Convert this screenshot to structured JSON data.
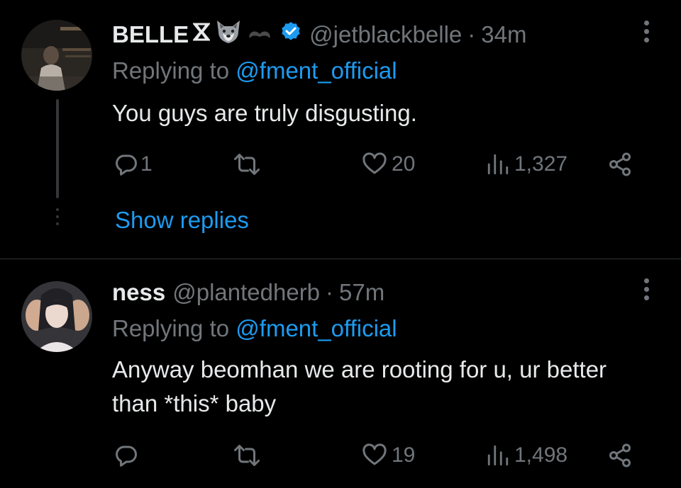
{
  "tweets": [
    {
      "display_name": "BELLE",
      "name_emojis": [
        "x-emoji",
        "wolf-emoji",
        "mustache-emoji"
      ],
      "verified": true,
      "handle": "@jetblackbelle",
      "dot": "·",
      "time": "34m",
      "replying_prefix": "Replying to",
      "replying_to": "@fment_official",
      "text": "You guys are truly disgusting.",
      "replies": "1",
      "retweets": "",
      "likes": "20",
      "views": "1,327",
      "show_replies": "Show replies"
    },
    {
      "display_name": "ness",
      "verified": false,
      "handle": "@plantedherb",
      "dot": "·",
      "time": "57m",
      "replying_prefix": "Replying to",
      "replying_to": "@fment_official",
      "text": "Anyway beomhan we are rooting for u, ur better than *this* baby",
      "replies": "",
      "retweets": "",
      "likes": "19",
      "views": "1,498"
    }
  ],
  "colors": {
    "background": "#000000",
    "text": "#e7e9ea",
    "muted": "#71767b",
    "accent": "#1d9bf0",
    "divider": "#2f3336"
  },
  "icons": {
    "reply": "reply-icon",
    "retweet": "retweet-icon",
    "like": "heart-icon",
    "views": "views-icon",
    "share": "share-icon",
    "more": "more-icon",
    "verified": "verified-badge-icon"
  }
}
